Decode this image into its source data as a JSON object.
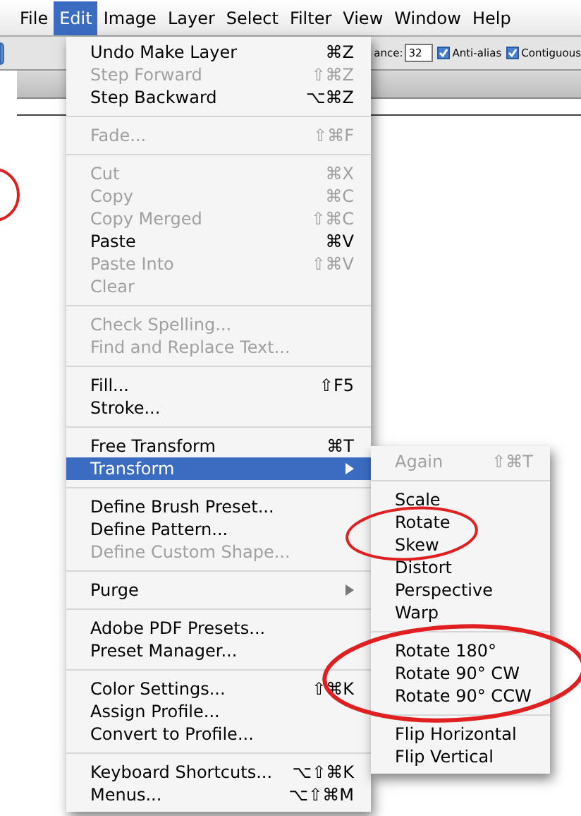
{
  "menu_bar": [
    {
      "label": "File",
      "selected": false
    },
    {
      "label": "Edit",
      "selected": true
    },
    {
      "label": "Image",
      "selected": false
    },
    {
      "label": "Layer",
      "selected": false
    },
    {
      "label": "Select",
      "selected": false
    },
    {
      "label": "Filter",
      "selected": false
    },
    {
      "label": "View",
      "selected": false
    },
    {
      "label": "Window",
      "selected": false
    },
    {
      "label": "Help",
      "selected": false
    }
  ],
  "options_bar": {
    "tolerance_label": "ance:",
    "tolerance_value": "32",
    "checkboxes": [
      {
        "label": "Anti-alias",
        "checked": true
      },
      {
        "label": "Contiguous",
        "checked": true
      }
    ]
  },
  "edit_menu": {
    "sections": [
      [
        {
          "label": "Undo Make Layer",
          "shortcut": "⌘Z",
          "disabled": false,
          "selected": false
        },
        {
          "label": "Step Forward",
          "shortcut": "⇧⌘Z",
          "disabled": true,
          "selected": false
        },
        {
          "label": "Step Backward",
          "shortcut": "⌥⌘Z",
          "disabled": false,
          "selected": false
        }
      ],
      [
        {
          "label": "Fade...",
          "shortcut": "⇧⌘F",
          "disabled": true,
          "selected": false
        }
      ],
      [
        {
          "label": "Cut",
          "shortcut": "⌘X",
          "disabled": true,
          "selected": false
        },
        {
          "label": "Copy",
          "shortcut": "⌘C",
          "disabled": true,
          "selected": false
        },
        {
          "label": "Copy Merged",
          "shortcut": "⇧⌘C",
          "disabled": true,
          "selected": false
        },
        {
          "label": "Paste",
          "shortcut": "⌘V",
          "disabled": false,
          "selected": false
        },
        {
          "label": "Paste Into",
          "shortcut": "⇧⌘V",
          "disabled": true,
          "selected": false
        },
        {
          "label": "Clear",
          "disabled": true,
          "selected": false
        }
      ],
      [
        {
          "label": "Check Spelling...",
          "disabled": true,
          "selected": false
        },
        {
          "label": "Find and Replace Text...",
          "disabled": true,
          "selected": false
        }
      ],
      [
        {
          "label": "Fill...",
          "shortcut": "⇧F5",
          "disabled": false,
          "selected": false
        },
        {
          "label": "Stroke...",
          "disabled": false,
          "selected": false
        }
      ],
      [
        {
          "label": "Free Transform",
          "shortcut": "⌘T",
          "disabled": false,
          "selected": false
        },
        {
          "label": "Transform",
          "submenu": true,
          "disabled": false,
          "selected": true
        }
      ],
      [
        {
          "label": "Define Brush Preset...",
          "disabled": false,
          "selected": false
        },
        {
          "label": "Define Pattern...",
          "disabled": false,
          "selected": false
        },
        {
          "label": "Define Custom Shape...",
          "disabled": true,
          "selected": false
        }
      ],
      [
        {
          "label": "Purge",
          "submenu": true,
          "disabled": false,
          "selected": false
        }
      ],
      [
        {
          "label": "Adobe PDF Presets...",
          "disabled": false,
          "selected": false
        },
        {
          "label": "Preset Manager...",
          "disabled": false,
          "selected": false
        }
      ],
      [
        {
          "label": "Color Settings...",
          "shortcut": "⇧⌘K",
          "disabled": false,
          "selected": false
        },
        {
          "label": "Assign Profile...",
          "disabled": false,
          "selected": false
        },
        {
          "label": "Convert to Profile...",
          "disabled": false,
          "selected": false
        }
      ],
      [
        {
          "label": "Keyboard Shortcuts...",
          "shortcut": "⌥⇧⌘K",
          "disabled": false,
          "selected": false
        },
        {
          "label": "Menus...",
          "shortcut": "⌥⇧⌘M",
          "disabled": false,
          "selected": false
        }
      ]
    ]
  },
  "transform_submenu": {
    "sections": [
      [
        {
          "label": "Again",
          "shortcut": "⇧⌘T",
          "disabled": true,
          "selected": false
        }
      ],
      [
        {
          "label": "Scale",
          "disabled": false,
          "selected": false
        },
        {
          "label": "Rotate",
          "disabled": false,
          "selected": false
        },
        {
          "label": "Skew",
          "disabled": false,
          "selected": false
        },
        {
          "label": "Distort",
          "disabled": false,
          "selected": false
        },
        {
          "label": "Perspective",
          "disabled": false,
          "selected": false
        },
        {
          "label": "Warp",
          "disabled": false,
          "selected": false
        }
      ],
      [
        {
          "label": "Rotate 180°",
          "disabled": false,
          "selected": false
        },
        {
          "label": "Rotate 90° CW",
          "disabled": false,
          "selected": false
        },
        {
          "label": "Rotate 90° CCW",
          "disabled": false,
          "selected": false
        }
      ],
      [
        {
          "label": "Flip Horizontal",
          "disabled": false,
          "selected": false
        },
        {
          "label": "Flip Vertical",
          "disabled": false,
          "selected": false
        }
      ]
    ]
  }
}
